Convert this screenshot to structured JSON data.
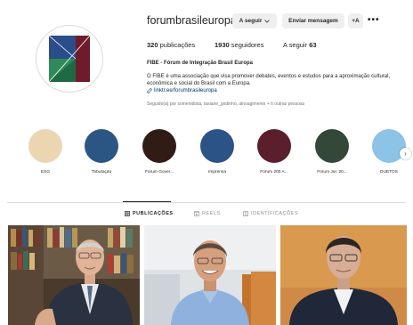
{
  "profile": {
    "username": "forumbrasileuropa",
    "follow_label": "A seguir",
    "message_label": "Enviar mensagem",
    "add_label": "+A",
    "more_label": "•••",
    "stats": {
      "posts_count": "320",
      "posts_label": "publicações",
      "followers_count": "1930",
      "followers_label": "seguidores",
      "following_label": "A seguir",
      "following_count": "63"
    },
    "bio": {
      "name": "FIBE - Fórum de Integração Brasil Europa",
      "description": "O FIBE é uma associação que visa promover debates, eventos e estudos para a aproximação cultural, econômica e social do Brasil com a Europa.",
      "link": "linktr.ee/forumbrasileuropa"
    },
    "followed_by": "Seguido(a) por somenidista, tasiane_godinho, alnoagimeres + 6 outras pessoas"
  },
  "highlights": [
    {
      "label": "ESG",
      "color": "#ecd6b2"
    },
    {
      "label": "Tributação",
      "color": "#2b5583"
    },
    {
      "label": "Fórum Gover...",
      "color": "#311c15"
    },
    {
      "label": "Imprensa",
      "color": "#2c5386"
    },
    {
      "label": "Fórum 200 A...",
      "color": "#5b1e2b"
    },
    {
      "label": "Fórum Jur. 20...",
      "color": "#334838"
    },
    {
      "label": "DUETOS",
      "color": "#8cc3e6"
    }
  ],
  "tabs": [
    {
      "label": "PUBLICAÇÕES",
      "active": true
    },
    {
      "label": "REELS",
      "active": false
    },
    {
      "label": "IDENTIFICAÇÕES",
      "active": false
    }
  ],
  "icons": {
    "link": "link-icon",
    "chevron": "chevron-down-icon",
    "next": "chevron-right-icon",
    "grid": "grid-icon",
    "reels": "reels-icon",
    "tagged": "tagged-icon"
  }
}
